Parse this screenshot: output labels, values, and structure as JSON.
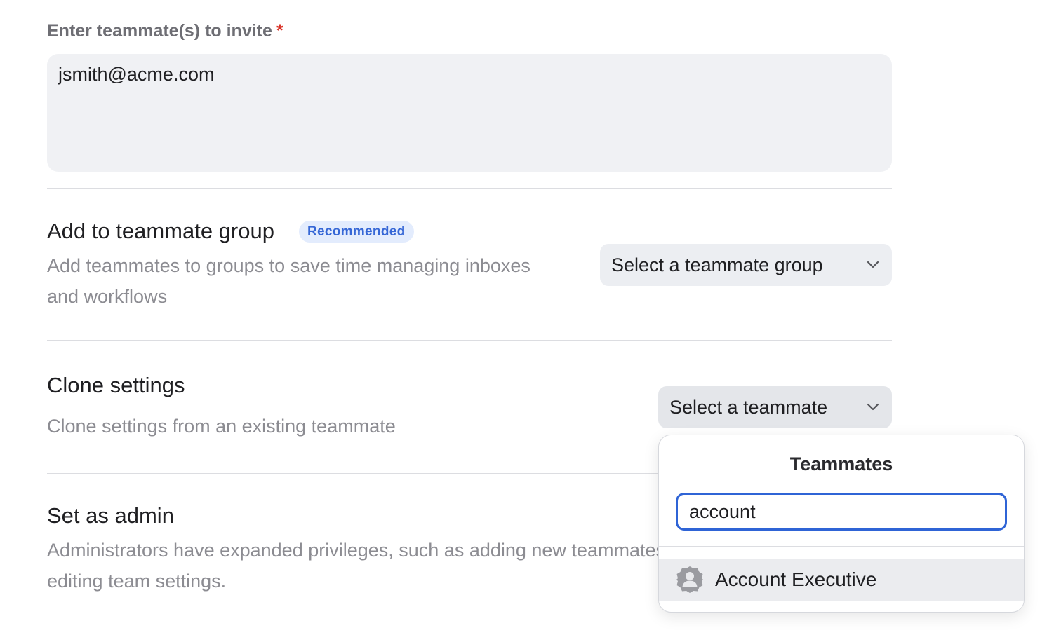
{
  "invite": {
    "label": "Enter teammate(s) to invite",
    "required_mark": "*",
    "value": "jsmith@acme.com"
  },
  "group": {
    "title": "Add to teammate group",
    "badge": "Recommended",
    "description_line1": "Add teammates to groups to save time managing inboxes",
    "description_line2": "and workflows",
    "select_placeholder": "Select a teammate group"
  },
  "clone": {
    "title": "Clone settings",
    "description": "Clone settings from an existing teammate",
    "select_placeholder": "Select a teammate"
  },
  "admin": {
    "title": "Set as admin",
    "description_line1": "Administrators have expanded privileges, such as adding new teammates and",
    "description_line2": "editing team settings."
  },
  "popover": {
    "title": "Teammates",
    "search_value": "account",
    "results": [
      {
        "label": "Account Executive",
        "icon": "group-avatar-icon"
      }
    ]
  },
  "colors": {
    "accent": "#2f64d6",
    "badge_bg": "#e3ecfd",
    "badge_text": "#3667d6",
    "required": "#d93025"
  }
}
